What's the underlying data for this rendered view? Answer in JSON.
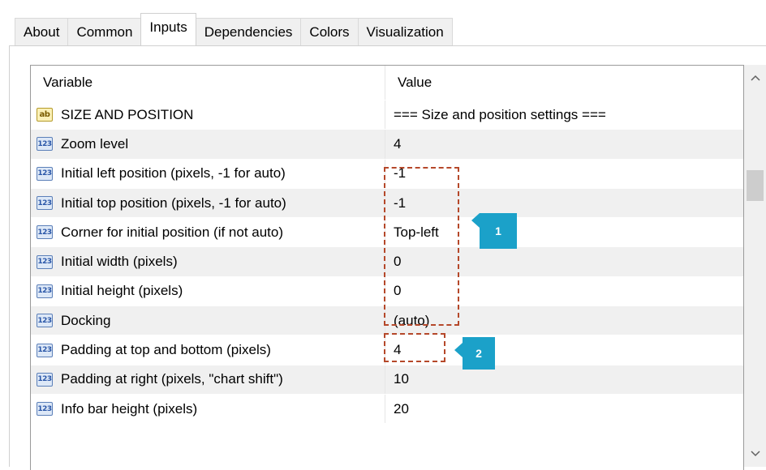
{
  "tabs": [
    {
      "label": "About"
    },
    {
      "label": "Common"
    },
    {
      "label": "Inputs",
      "active": true
    },
    {
      "label": "Dependencies"
    },
    {
      "label": "Colors"
    },
    {
      "label": "Visualization"
    }
  ],
  "grid": {
    "headers": {
      "variable": "Variable",
      "value": "Value"
    },
    "rows": [
      {
        "icon": "ab",
        "variable": "SIZE AND POSITION",
        "value": "=== Size and position settings ==="
      },
      {
        "icon": "123",
        "variable": "Zoom level",
        "value": "4"
      },
      {
        "icon": "123",
        "variable": "Initial left position (pixels, -1 for auto)",
        "value": "-1"
      },
      {
        "icon": "123",
        "variable": "Initial top position (pixels, -1 for auto)",
        "value": "-1"
      },
      {
        "icon": "123",
        "variable": "Corner for initial position (if not auto)",
        "value": "Top-left"
      },
      {
        "icon": "123",
        "variable": "Initial width (pixels)",
        "value": "0"
      },
      {
        "icon": "123",
        "variable": "Initial height (pixels)",
        "value": "0"
      },
      {
        "icon": "123",
        "variable": "Docking",
        "value": "(auto)"
      },
      {
        "icon": "123",
        "variable": "Padding at top and bottom (pixels)",
        "value": "4"
      },
      {
        "icon": "123",
        "variable": "Padding at right (pixels, \"chart shift\")",
        "value": "10"
      },
      {
        "icon": "123",
        "variable": "Info bar height (pixels)",
        "value": "20"
      }
    ]
  },
  "scrollbar": {
    "up_icon": "chevron-up-icon",
    "down_icon": "chevron-down-icon"
  },
  "callouts": [
    {
      "label": "1"
    },
    {
      "label": "2"
    }
  ],
  "colors": {
    "callout_badge": "#1ba1c9",
    "callout_outline": "#b5482a",
    "row_alt": "#f0f0f0"
  }
}
